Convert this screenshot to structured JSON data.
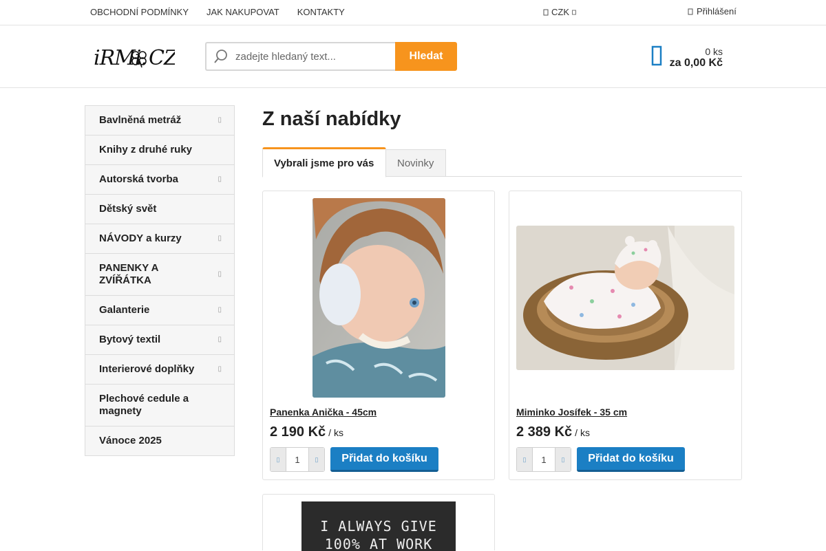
{
  "topbar": {
    "nav": [
      "OBCHODNÍ PODMÍNKY",
      "JAK NAKUPOVAT",
      "KONTAKTY"
    ],
    "currency": "CZK",
    "login": "Přihlášení"
  },
  "header": {
    "logo": "iRMi.❀CZ",
    "search_placeholder": "zadejte hledaný text...",
    "search_button": "Hledat",
    "cart_count": "0 ks",
    "cart_total": "za 0,00 Kč"
  },
  "sidebar": {
    "items": [
      {
        "label": "Bavlněná metráž",
        "has_sub": true
      },
      {
        "label": "Knihy z druhé ruky",
        "has_sub": false
      },
      {
        "label": "Autorská tvorba",
        "has_sub": true
      },
      {
        "label": "Dětský svět",
        "has_sub": false
      },
      {
        "label": "NÁVODY a kurzy",
        "has_sub": true
      },
      {
        "label": "PANENKY A ZVÍŘÁTKA",
        "has_sub": true
      },
      {
        "label": "Galanterie",
        "has_sub": true
      },
      {
        "label": "Bytový textil",
        "has_sub": true
      },
      {
        "label": "Interierové doplňky",
        "has_sub": true
      },
      {
        "label": "Plechové cedule a magnety",
        "has_sub": false
      },
      {
        "label": "Vánoce 2025",
        "has_sub": false
      }
    ]
  },
  "main": {
    "title": "Z naší nabídky",
    "tabs": [
      "Vybrali jsme pro vás",
      "Novinky"
    ],
    "products": [
      {
        "name": "Panenka Anička - 45cm",
        "price": "2 190 Kč",
        "unit": "/ ks",
        "qty": "1",
        "button": "Přidat do košíku"
      },
      {
        "name": "Miminko Josífek - 35 cm",
        "price": "2 389 Kč",
        "unit": "/ ks",
        "qty": "1",
        "button": "Přidat do košíku"
      },
      {
        "sign_text": [
          "I ALWAYS GIVE",
          "100% AT WORK"
        ]
      }
    ]
  },
  "colors": {
    "accent": "#f7941d",
    "button_blue": "#1b7fc4"
  }
}
